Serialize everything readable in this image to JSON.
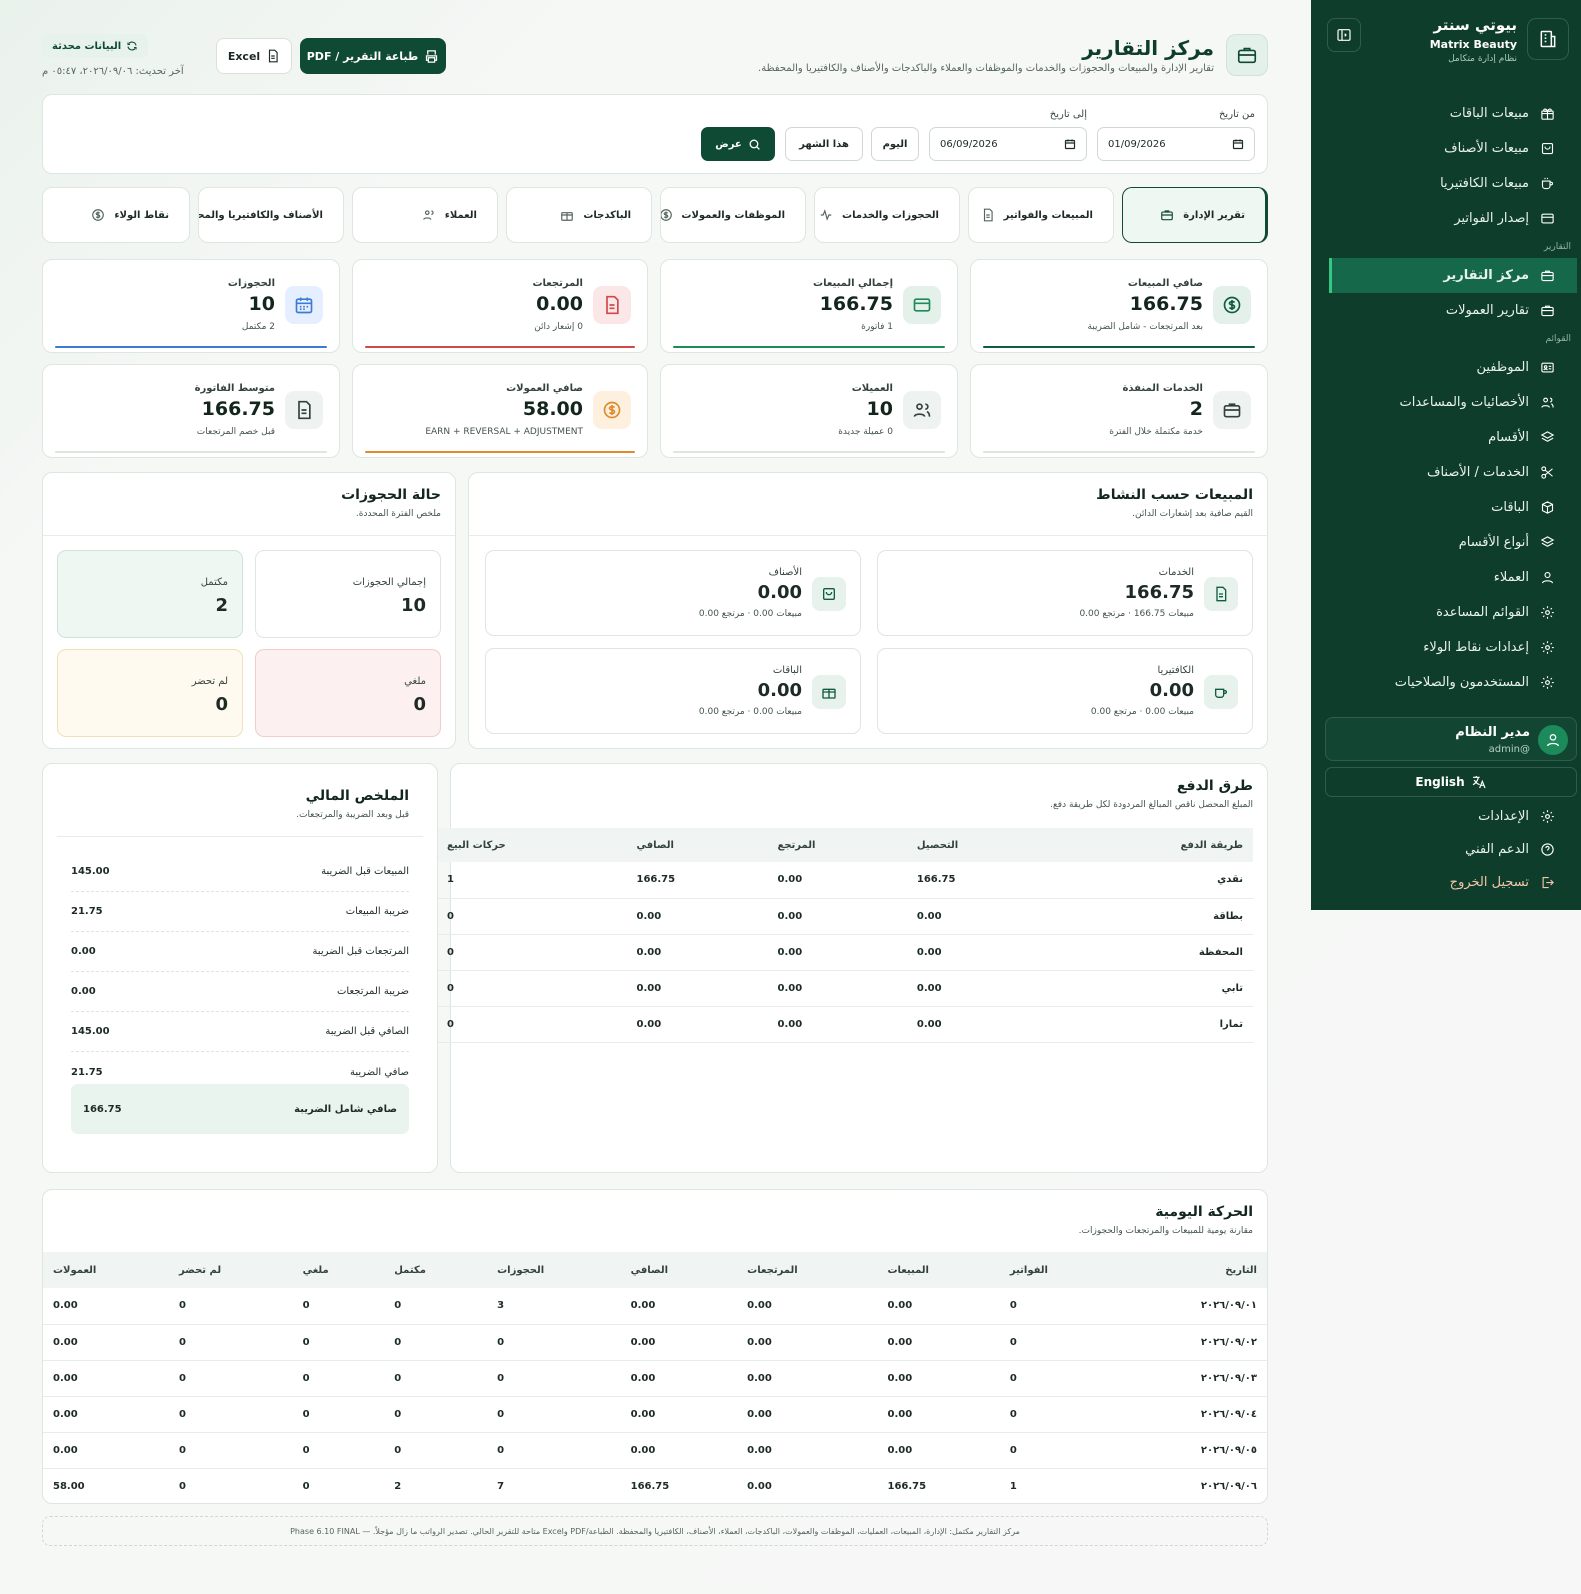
{
  "sidebar": {
    "brand_title": "بيوتي سنتر",
    "brand_en": "Matrix Beauty",
    "brand_sub": "نظام إدارة متكامل",
    "items_top": [
      {
        "label": "مبيعات الباقات",
        "icon": "gift-icon"
      },
      {
        "label": "مبيعات الأصناف",
        "icon": "bag-icon"
      },
      {
        "label": "مبيعات الكافتيريا",
        "icon": "cup-icon"
      },
      {
        "label": "إصدار الفواتير",
        "icon": "card-icon"
      }
    ],
    "section_reports": "التقارير",
    "items_reports": [
      {
        "label": "مركز التقارير",
        "icon": "briefcase-icon"
      },
      {
        "label": "تقارير العمولات",
        "icon": "briefcase-icon"
      }
    ],
    "section_lists": "القوائم",
    "items_lists": [
      {
        "label": "الموظفين",
        "icon": "id-card-icon"
      },
      {
        "label": "الأخصائيات والمساعدات",
        "icon": "users-icon"
      },
      {
        "label": "الأقسام",
        "icon": "layers-icon"
      },
      {
        "label": "الخدمات / الأصناف",
        "icon": "scissors-icon"
      },
      {
        "label": "الباقات",
        "icon": "box-icon"
      },
      {
        "label": "أنواع الأقسام",
        "icon": "layers-icon"
      },
      {
        "label": "العملاء",
        "icon": "user-icon"
      },
      {
        "label": "القوائم المساعدة",
        "icon": "gear-icon"
      },
      {
        "label": "إعدادات نقاط الولاء",
        "icon": "gear-icon"
      },
      {
        "label": "المستخدمون والصلاحيات",
        "icon": "gear-icon"
      }
    ],
    "user_name": "مدير النظام",
    "user_handle": "@admin",
    "lang_label": "English",
    "settings": "الإعدادات",
    "support": "الدعم الفني",
    "logout": "تسجيل الخروج"
  },
  "header": {
    "title": "مركز التقارير",
    "subtitle": "تقارير الإدارة والمبيعات والحجوزات والخدمات والموظفات والعملاء والباكدجات والأصناف والكافتيريا والمحفظة.",
    "print_btn": "طباعة التقرير / PDF",
    "excel_btn": "Excel",
    "updated_badge": "البيانات محدثة",
    "last_update": "آخر تحديث: ٢٠٢٦/٠٩/٠٦، ٠٥:٤٧ م"
  },
  "filter": {
    "from_label": "من تاريخ",
    "from_value": "01/09/2026",
    "to_label": "إلى تاريخ",
    "to_value": "06/09/2026",
    "today_btn": "اليوم",
    "month_btn": "هذا الشهر",
    "show_btn": "عرض"
  },
  "tabs": [
    {
      "label": "تقرير الإدارة",
      "icon": "briefcase-icon"
    },
    {
      "label": "المبيعات والفواتير",
      "icon": "document-icon"
    },
    {
      "label": "الحجوزات والخدمات",
      "icon": "pulse-icon"
    },
    {
      "label": "الموظفات والعمولات",
      "icon": "dollar-icon"
    },
    {
      "label": "الباكدجات",
      "icon": "gift-icon"
    },
    {
      "label": "العملاء",
      "icon": "users-icon"
    },
    {
      "label": "الأصناف والكافتيريا والمحفظة",
      "icon": "bag-icon"
    },
    {
      "label": "نقاط الولاء",
      "icon": "dollar-icon"
    }
  ],
  "kpis_row1": [
    {
      "label": "صافي المبيعات",
      "value": "166.75",
      "sub": "بعد المرتجعات - شامل الضريبة",
      "color": "#0f5c3e"
    },
    {
      "label": "إجمالي المبيعات",
      "value": "166.75",
      "sub": "1 فاتورة",
      "color": "#1d8a58"
    },
    {
      "label": "المرتجعات",
      "value": "0.00",
      "sub": "0 إشعار دائن",
      "color": "#d04848"
    },
    {
      "label": "الحجوزات",
      "value": "10",
      "sub": "2 مكتمل",
      "color": "#3b7bd6"
    }
  ],
  "kpis_row2": [
    {
      "label": "الخدمات المنفذة",
      "value": "2",
      "sub": "خدمة مكتملة خلال الفترة",
      "color": "#dde6e1"
    },
    {
      "label": "العميلات",
      "value": "10",
      "sub": "0 عميلة جديدة",
      "color": "#dde6e1"
    },
    {
      "label": "صافي العمولات",
      "value": "58.00",
      "sub": "EARN + REVERSAL + ADJUSTMENT",
      "color": "#e08a2a"
    },
    {
      "label": "متوسط الفاتورة",
      "value": "166.75",
      "sub": "قبل خصم المرتجعات",
      "color": "#dde6e1"
    }
  ],
  "activity": {
    "title": "المبيعات حسب النشاط",
    "subtitle": "القيم صافية بعد إشعارات الدائن.",
    "boxes": [
      {
        "label": "الخدمات",
        "value": "166.75",
        "sub": "مبيعات 166.75 · مرتجع 0.00"
      },
      {
        "label": "الأصناف",
        "value": "0.00",
        "sub": "مبيعات 0.00 · مرتجع 0.00"
      },
      {
        "label": "الكافتيريا",
        "value": "0.00",
        "sub": "مبيعات 0.00 · مرتجع 0.00"
      },
      {
        "label": "الباقات",
        "value": "0.00",
        "sub": "مبيعات 0.00 · مرتجع 0.00"
      }
    ]
  },
  "bookings": {
    "title": "حالة الحجوزات",
    "subtitle": "ملخص الفترة المحددة.",
    "boxes": [
      {
        "label": "إجمالي الحجوزات",
        "value": "10"
      },
      {
        "label": "مكتمل",
        "value": "2"
      },
      {
        "label": "ملغي",
        "value": "0"
      },
      {
        "label": "لم تحضر",
        "value": "0"
      }
    ]
  },
  "payments": {
    "title": "طرق الدفع",
    "subtitle": "المبلغ المحصل ناقص المبالغ المردودة لكل طريقة دفع.",
    "columns": [
      "طريقة الدفع",
      "التحصيل",
      "المرتجع",
      "الصافي",
      "حركات البيع"
    ],
    "rows": [
      [
        "نقدي",
        "166.75",
        "0.00",
        "166.75",
        "1"
      ],
      [
        "بطاقة",
        "0.00",
        "0.00",
        "0.00",
        "0"
      ],
      [
        "المحفظة",
        "0.00",
        "0.00",
        "0.00",
        "0"
      ],
      [
        "تابي",
        "0.00",
        "0.00",
        "0.00",
        "0"
      ],
      [
        "تمارا",
        "0.00",
        "0.00",
        "0.00",
        "0"
      ]
    ]
  },
  "financial": {
    "title": "الملخص المالي",
    "subtitle": "قبل وبعد الضريبة والمرتجعات.",
    "rows": [
      {
        "label": "المبيعات قبل الضريبة",
        "value": "145.00"
      },
      {
        "label": "ضريبة المبيعات",
        "value": "21.75"
      },
      {
        "label": "المرتجعات قبل الضريبة",
        "value": "0.00"
      },
      {
        "label": "ضريبة المرتجعات",
        "value": "0.00"
      },
      {
        "label": "الصافي قبل الضريبة",
        "value": "145.00"
      },
      {
        "label": "صافي الضريبة",
        "value": "21.75"
      }
    ],
    "total_label": "صافي شامل الضريبة",
    "total_value": "166.75"
  },
  "daily": {
    "title": "الحركة اليومية",
    "subtitle": "مقارنة يومية للمبيعات والمرتجعات والحجوزات.",
    "columns": [
      "التاريخ",
      "الفواتير",
      "المبيعات",
      "المرتجعات",
      "الصافي",
      "الحجوزات",
      "مكتمل",
      "ملغي",
      "لم تحضر",
      "العمولات"
    ],
    "rows": [
      [
        "٢٠٢٦/٠٩/٠١",
        "0",
        "0.00",
        "0.00",
        "0.00",
        "3",
        "0",
        "0",
        "0",
        "0.00"
      ],
      [
        "٢٠٢٦/٠٩/٠٢",
        "0",
        "0.00",
        "0.00",
        "0.00",
        "0",
        "0",
        "0",
        "0",
        "0.00"
      ],
      [
        "٢٠٢٦/٠٩/٠٣",
        "0",
        "0.00",
        "0.00",
        "0.00",
        "0",
        "0",
        "0",
        "0",
        "0.00"
      ],
      [
        "٢٠٢٦/٠٩/٠٤",
        "0",
        "0.00",
        "0.00",
        "0.00",
        "0",
        "0",
        "0",
        "0",
        "0.00"
      ],
      [
        "٢٠٢٦/٠٩/٠٥",
        "0",
        "0.00",
        "0.00",
        "0.00",
        "0",
        "0",
        "0",
        "0",
        "0.00"
      ],
      [
        "٢٠٢٦/٠٩/٠٦",
        "1",
        "166.75",
        "0.00",
        "166.75",
        "7",
        "2",
        "0",
        "0",
        "58.00"
      ]
    ]
  },
  "footer_note": "مركز التقارير مكتمل: الإدارة، المبيعات، العمليات، الموظفات والعمولات، الباكدجات، العملاء، الأصناف، الكافتيريا والمحفظة. الطباعة/PDF وExcel متاحة للتقرير الحالي. تصدير الرواتب ما زال مؤجلاً. — Phase 6.10 FINAL"
}
